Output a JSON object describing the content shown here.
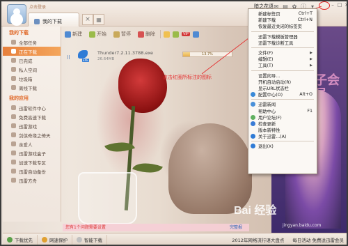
{
  "titlebar": {
    "user_label": "点击登录",
    "tab_label": "我的下载",
    "tab_close": "×",
    "tab_grid": "▦",
    "username": "暗之花语",
    "icons": [
      "mail-icon",
      "calendar-icon",
      "skin-icon",
      "menu-icon"
    ],
    "window_buttons": [
      "–",
      "□",
      "×"
    ]
  },
  "toolbar": {
    "new_label": "新建",
    "start_label": "开始",
    "pause_label": "暂停",
    "delete_label": "删除",
    "vip_label": "VIP"
  },
  "sidebar": {
    "section1": "我的下载",
    "items1": [
      {
        "label": "全部任务"
      },
      {
        "label": "正在下载",
        "active": true
      },
      {
        "label": "已完成"
      },
      {
        "label": "私人空间"
      },
      {
        "label": "垃圾箱"
      },
      {
        "label": "离线下载"
      }
    ],
    "section2": "我的应用",
    "items2": [
      {
        "label": "迅雷软件中心"
      },
      {
        "label": "免费高速下载"
      },
      {
        "label": "迅雷游戏"
      },
      {
        "label": "剑侠奇缘之倚天"
      },
      {
        "label": "亲爱人"
      },
      {
        "label": "迅雷游戏盒子"
      },
      {
        "label": "加速下载专区"
      },
      {
        "label": "迅雷自动备份"
      },
      {
        "label": "迅雷方舟"
      }
    ]
  },
  "download": {
    "pause_glyph": "II",
    "file_tag": "EXE",
    "name": "Thunder7.2.11.3788.exe",
    "size": "26.64MB",
    "progress": 13.7,
    "progress_label": "13.7%"
  },
  "annotation": "点击红圈所标注的图标",
  "tipbar": {
    "text": "您有1个问题需要设置",
    "link": "完整报"
  },
  "bottombar": {
    "item1": "下载优先",
    "item2": "网速保护",
    "item3": "智能下载",
    "news": "2012年网络流行语大盘点",
    "promo": "每日活动 免费送迅雷会员"
  },
  "rightpanel": {
    "text": "子会员"
  },
  "watermark": {
    "main": "Bai 经验",
    "sub": "jingyan.baidu.com"
  },
  "menu": {
    "items": [
      {
        "label": "新建标签页",
        "shortcut": "Ctrl+T"
      },
      {
        "label": "新建下载",
        "shortcut": "Ctrl+N"
      },
      {
        "label": "恢复最近关闭的标签页",
        "shortcut": ""
      },
      {
        "sep": true
      },
      {
        "label": "迅雷下载模板管理器",
        "shortcut": ""
      },
      {
        "label": "迅雷下载诊断工具",
        "shortcut": ""
      },
      {
        "sep": true
      },
      {
        "label": "文件(F)",
        "submenu": true
      },
      {
        "label": "编辑(E)",
        "submenu": true
      },
      {
        "label": "工具(T)",
        "submenu": true
      },
      {
        "sep": true
      },
      {
        "label": "设置向导...",
        "shortcut": ""
      },
      {
        "label": "开机自动启动(R)",
        "shortcut": ""
      },
      {
        "label": "显示URL状态栏",
        "shortcut": ""
      },
      {
        "label": "配置中心(O)",
        "shortcut": "Alt+O",
        "icon": "#3a8ad8"
      },
      {
        "sep": true
      },
      {
        "label": "迅雷新闻",
        "shortcut": "",
        "icon": "#4a90d9"
      },
      {
        "label": "帮助中心",
        "shortcut": "F1"
      },
      {
        "label": "用户论坛(F)",
        "shortcut": "",
        "icon": "#60b060"
      },
      {
        "label": "检查更新",
        "shortcut": "",
        "icon": "#3a7bd5"
      },
      {
        "label": "版本新特性",
        "shortcut": ""
      },
      {
        "label": "关于迅雷...(A)",
        "shortcut": "",
        "icon": "#2f7bd6"
      },
      {
        "sep": true
      },
      {
        "label": "退出(X)",
        "shortcut": "",
        "icon": "#2f7bd6"
      }
    ]
  }
}
